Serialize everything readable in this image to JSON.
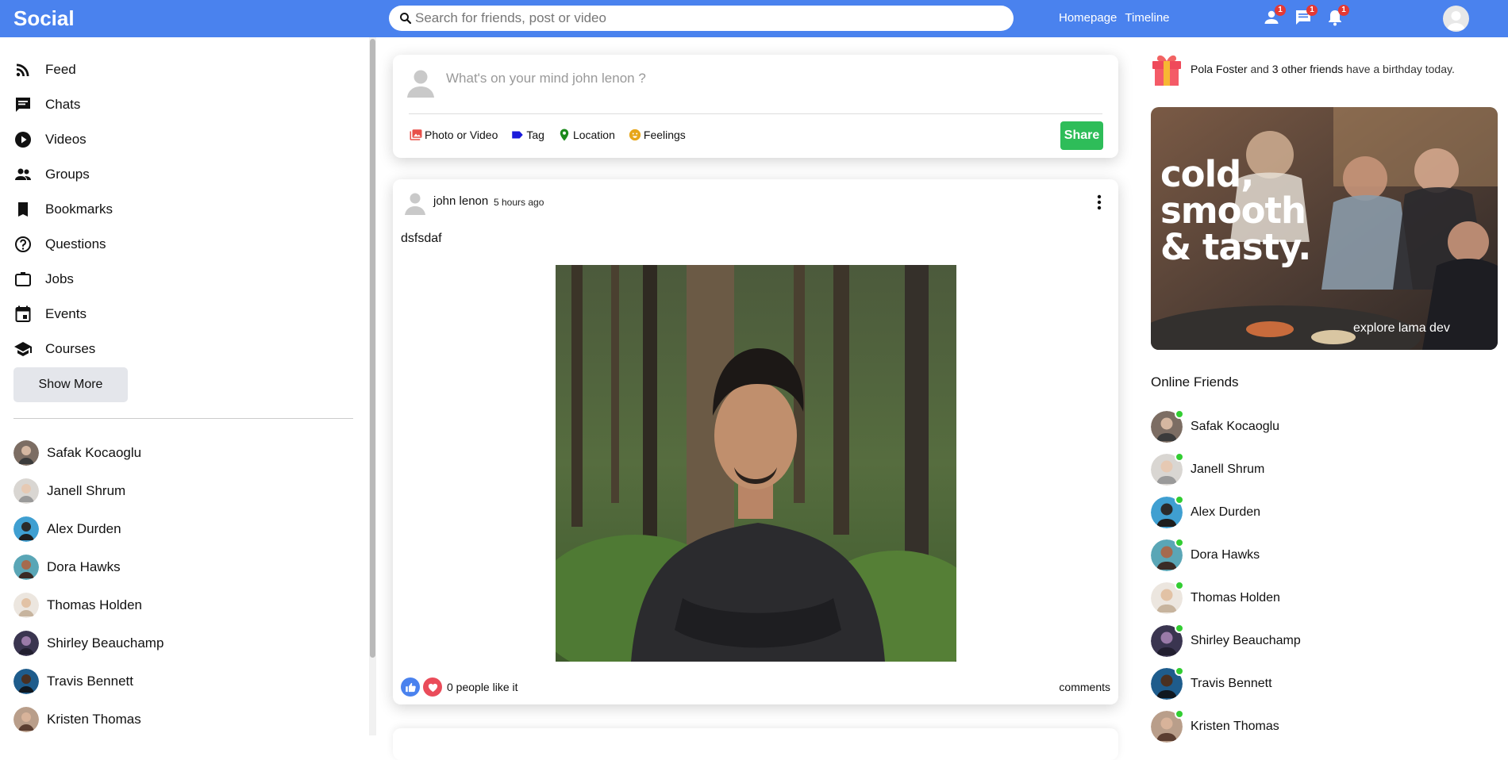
{
  "topbar": {
    "logo": "Social",
    "search_placeholder": "Search for friends, post or video",
    "links": [
      "Homepage",
      "Timeline"
    ],
    "badges": {
      "person": "1",
      "chat": "1",
      "notifications": "1"
    },
    "accent_color": "#4a82ee"
  },
  "sidebar": {
    "menu": [
      {
        "label": "Feed",
        "icon": "rss-feed-icon"
      },
      {
        "label": "Chats",
        "icon": "chat-icon"
      },
      {
        "label": "Videos",
        "icon": "play-circle-icon"
      },
      {
        "label": "Groups",
        "icon": "group-icon"
      },
      {
        "label": "Bookmarks",
        "icon": "bookmark-icon"
      },
      {
        "label": "Questions",
        "icon": "help-circle-icon"
      },
      {
        "label": "Jobs",
        "icon": "work-icon"
      },
      {
        "label": "Events",
        "icon": "event-icon"
      },
      {
        "label": "Courses",
        "icon": "school-icon"
      }
    ],
    "show_more": "Show More",
    "friends": [
      "Safak Kocaoglu",
      "Janell Shrum",
      "Alex Durden",
      "Dora Hawks",
      "Thomas Holden",
      "Shirley Beauchamp",
      "Travis Bennett",
      "Kristen Thomas"
    ]
  },
  "share": {
    "placeholder": "What's on your mind john lenon ?",
    "options": [
      {
        "label": "Photo or Video",
        "icon": "perm-media-icon",
        "color": "#e8504a"
      },
      {
        "label": "Tag",
        "icon": "label-icon",
        "color": "#1a1adb"
      },
      {
        "label": "Location",
        "icon": "room-icon",
        "color": "#1b8a1b"
      },
      {
        "label": "Feelings",
        "icon": "emoji-icon",
        "color": "#e7a61a"
      }
    ],
    "button": "Share",
    "button_color": "#2ebd59"
  },
  "post": {
    "author": "john lenon",
    "date": "5 hours ago",
    "text": "dsfsdaf",
    "likes_text": "0 people like it",
    "comments_text": "comments"
  },
  "rightbar": {
    "birthday": {
      "name": "Pola Foster",
      "middle": "and",
      "others": "3 other friends",
      "end": "have a birthday today."
    },
    "ad": {
      "headline": [
        "cold,",
        "smooth",
        "& tasty."
      ],
      "tagline": "explore lama dev"
    },
    "online_title": "Online Friends",
    "online": [
      "Safak Kocaoglu",
      "Janell Shrum",
      "Alex Durden",
      "Dora Hawks",
      "Thomas Holden",
      "Shirley Beauchamp",
      "Travis Bennett",
      "Kristen Thomas"
    ],
    "online_color": "#32cd32"
  }
}
